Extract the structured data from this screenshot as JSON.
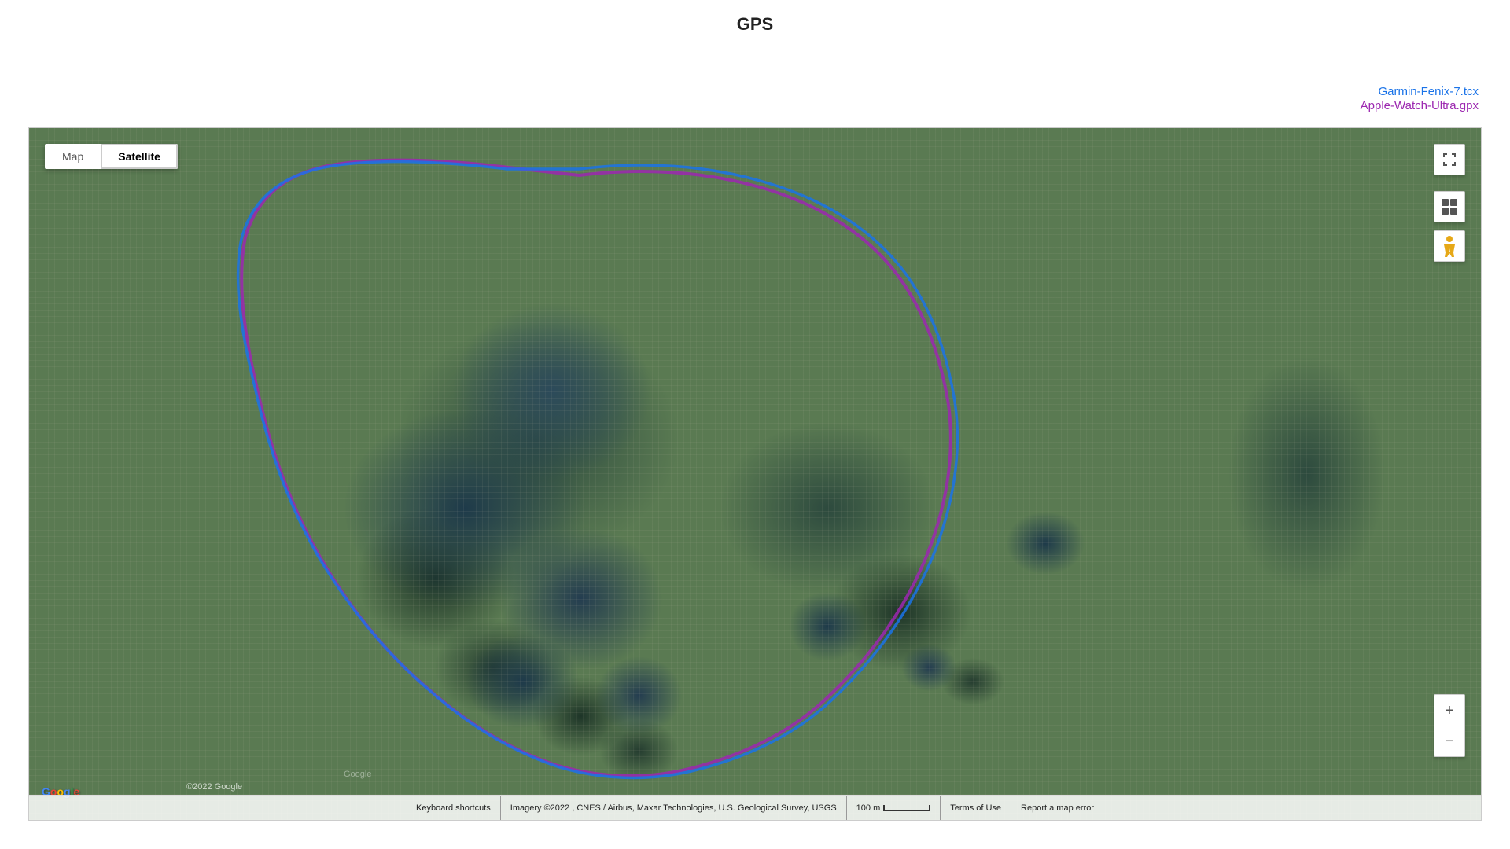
{
  "page": {
    "title": "GPS"
  },
  "legend": {
    "item1": {
      "label": "Garmin-Fenix-7.tcx",
      "color": "#1a73e8"
    },
    "item2": {
      "label": "Apple-Watch-Ultra.gpx",
      "color": "#9c27b0"
    }
  },
  "map": {
    "type_map_label": "Map",
    "type_satellite_label": "Satellite",
    "active_type": "Satellite",
    "fullscreen_icon": "⛶",
    "layers_icon": "layers",
    "pegman_icon": "♟",
    "zoom_in_label": "+",
    "zoom_out_label": "−",
    "google_text": "Google",
    "copyright_text": "©2022 Google",
    "copyright_text2": "Google",
    "bottom_bar": {
      "keyboard_shortcuts": "Keyboard shortcuts",
      "imagery_credit": "Imagery ©2022 , CNES / Airbus, Maxar Technologies, U.S. Geological Survey, USGS",
      "scale_label": "100 m",
      "terms_of_use": "Terms of Use",
      "report_error": "Report a map error"
    }
  }
}
